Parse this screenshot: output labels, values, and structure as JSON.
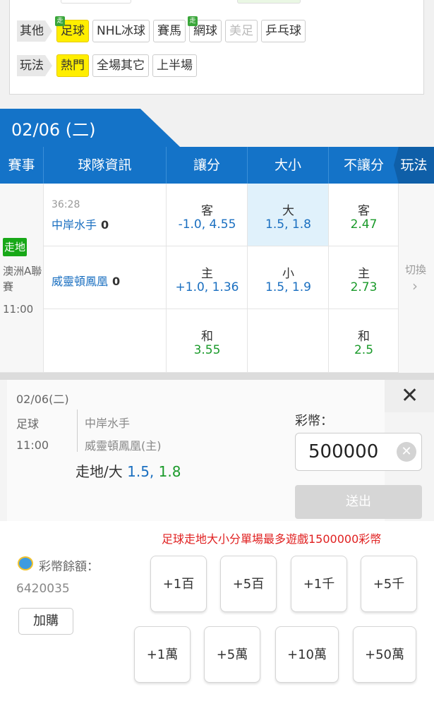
{
  "filters": {
    "other_label": "其他",
    "play_label": "玩法",
    "live_mark": "走",
    "sports": [
      {
        "label": "足球",
        "active": true,
        "live": true
      },
      {
        "label": "NHL冰球",
        "active": false,
        "live": false
      },
      {
        "label": "賽馬",
        "active": false,
        "live": false
      },
      {
        "label": "網球",
        "active": false,
        "live": true
      },
      {
        "label": "美足",
        "active": false,
        "disabled": true
      },
      {
        "label": "乒乓球",
        "active": false,
        "live": false
      }
    ],
    "plays": [
      {
        "label": "熱門",
        "active": true
      },
      {
        "label": "全場其它",
        "active": false
      },
      {
        "label": "上半場",
        "active": false
      }
    ]
  },
  "date": "02/06 (二)",
  "table": {
    "headers": {
      "event": "賽事",
      "team_info": "球隊資訊",
      "handicap": "讓分",
      "over_under": "大小",
      "moneyline": "不讓分",
      "play": "玩法"
    },
    "match": {
      "live_badge": "走地",
      "league": "澳洲A聯賽",
      "kickoff": "11:00",
      "clock": "36:28",
      "away_team": "中岸水手",
      "away_score": "0",
      "home_team": "威靈頓鳳凰",
      "home_score": "0",
      "handicap": [
        {
          "label": "客",
          "value": "-1.0, 4.55"
        },
        {
          "label": "主",
          "value": "+1.0, 1.36"
        }
      ],
      "over_under": [
        {
          "label": "大",
          "line": "1.5,",
          "odds": "1.8",
          "selected": true
        },
        {
          "label": "小",
          "line": "1.5,",
          "odds": "1.9"
        }
      ],
      "moneyline": [
        {
          "label": "客",
          "value": "2.47"
        },
        {
          "label": "主",
          "value": "2.73"
        }
      ],
      "draw": [
        {
          "label": "和",
          "value": "3.55"
        },
        {
          "label": "和",
          "value": "2.5"
        }
      ],
      "switch_label": "切換",
      "switch_arrow": "›"
    }
  },
  "bet_slip": {
    "date": "02/06(二)",
    "sport": "足球",
    "time": "11:00",
    "team_away": "中岸水手",
    "team_home": "威靈頓鳳凰(主)",
    "bet_prefix": "走地/大",
    "bet_line": "1.5,",
    "bet_odds": "1.8",
    "close": "✕",
    "coin_label": "彩幣：",
    "amount": "500000",
    "clear": "✕",
    "send": "送出",
    "limit_message": "足球走地大小分單場最多遊戲1500000彩幣",
    "balance_label": "彩幣餘額：",
    "balance_value": "6420035",
    "topup": "加購",
    "chips_row1": [
      "+1百",
      "+5百",
      "+1千",
      "+5千"
    ],
    "chips_row2": [
      "+1萬",
      "+5萬",
      "+10萬",
      "+50萬"
    ]
  },
  "colors": {
    "primary_blue": "#1473c8",
    "active_chip": "#ffee00",
    "live_green": "#18a818",
    "odds_blue": "#1a6fc0",
    "odds_green": "#1a9a2a",
    "alert_red": "#e02020"
  }
}
